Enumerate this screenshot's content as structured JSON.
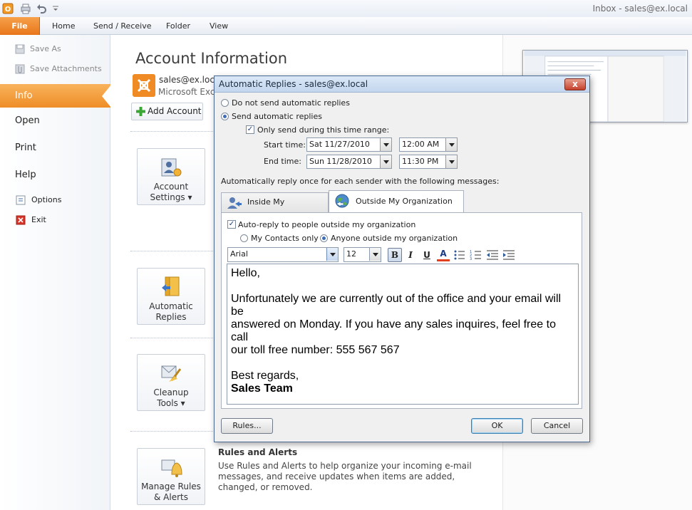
{
  "titlebar": {
    "window_title": "Inbox - sales@ex.local"
  },
  "ribbon": {
    "tabs": [
      "File",
      "Home",
      "Send / Receive",
      "Folder",
      "View"
    ]
  },
  "nav": {
    "save_as": "Save As",
    "save_attachments": "Save Attachments",
    "info": "Info",
    "open": "Open",
    "print": "Print",
    "help": "Help",
    "options": "Options",
    "exit": "Exit"
  },
  "main": {
    "title": "Account Information",
    "account_email": "sales@ex.local",
    "account_type": "Microsoft Exch",
    "add_account": "Add Account",
    "buttons": {
      "account_settings": [
        "Account",
        "Settings ▾"
      ],
      "automatic_replies": [
        "Automatic",
        "Replies"
      ],
      "cleanup_tools": [
        "Cleanup",
        "Tools ▾"
      ],
      "manage_rules": [
        "Manage Rules",
        "& Alerts"
      ]
    },
    "rules_title": "Rules and Alerts",
    "rules_desc": "Use Rules and Alerts to help organize your incoming e-mail messages, and receive updates when items are added, changed, or removed."
  },
  "dialog": {
    "title": "Automatic Replies - sales@ex.local",
    "close": "x",
    "do_not_send": "Do not send automatic replies",
    "send": "Send automatic replies",
    "only_during": "Only send during this time range:",
    "start_label": "Start time:",
    "start_date": "Sat 11/27/2010",
    "start_time": "12:00 AM",
    "end_label": "End time:",
    "end_date": "Sun 11/28/2010",
    "end_time": "11:30 PM",
    "reply_once": "Automatically reply once for each sender with the following messages:",
    "tab_inside": "Inside My Organization",
    "tab_outside": "Outside My Organization (On)",
    "auto_reply_outside": "Auto-reply to people outside my organization",
    "my_contacts": "My Contacts only",
    "anyone_outside": "Anyone outside my organization",
    "font": "Arial",
    "font_size": "12",
    "bold_glyph": "B",
    "italic_glyph": "I",
    "underline_glyph": "U",
    "fontcolor_glyph": "A",
    "message": {
      "line1": "Hello,",
      "line2": "Unfortunately we are currently out of the office and your email will be",
      "line3": "answered on Monday. If you have any sales inquires, feel free to call",
      "line4": "our toll free number: 555 567 567",
      "line5": "Best regards,",
      "line6": "Sales Team"
    },
    "rules_btn": "Rules...",
    "ok_btn": "OK",
    "cancel_btn": "Cancel"
  },
  "colors": {
    "file_tab": "#e8761a",
    "nav_selected": "#ee8d27",
    "dialog_titlebar": "#c3d6ee",
    "close_button": "#c5402b"
  }
}
